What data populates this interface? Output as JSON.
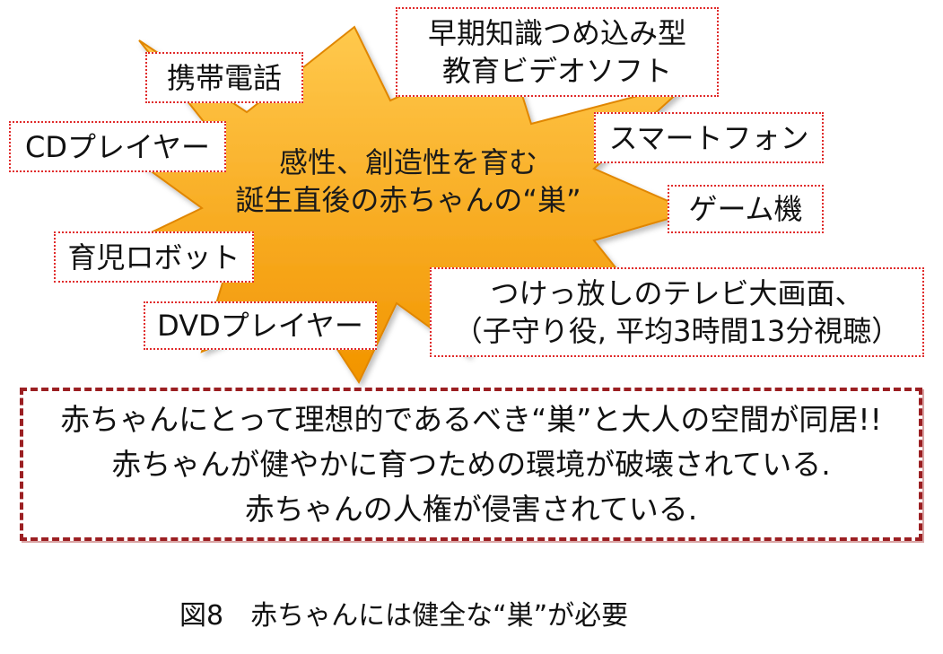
{
  "center": {
    "line1": "感性、創造性を育む",
    "line2": "誕生直後の赤ちゃんの“巣”"
  },
  "labels": {
    "mobile_phone": "携帯電話",
    "early_education_video": [
      "早期知識つめ込み型",
      "教育ビデオソフト"
    ],
    "cd_player": "CDプレイヤー",
    "smartphone": "スマートフォン",
    "game_console": "ゲーム機",
    "childcare_robot": "育児ロボット",
    "dvd_player": "DVDプレイヤー",
    "big_screen_tv": [
      "つけっ放しのテレビ大画面、",
      "（子守り役, 平均3時間13分視聴）"
    ]
  },
  "message": {
    "line1": "赤ちゃんにとって理想的であるべき“巣”と大人の空間が同居!!",
    "line2": "赤ちゃんが健やかに育つための環境が破壊されている.",
    "line3": "赤ちゃんの人権が侵害されている."
  },
  "caption": "図8　赤ちゃんには健全な“巣”が必要",
  "colors": {
    "star_light": "#ffc94d",
    "star_dark": "#f29400",
    "label_border": "#e02b2b",
    "message_border": "#9b1f22"
  }
}
